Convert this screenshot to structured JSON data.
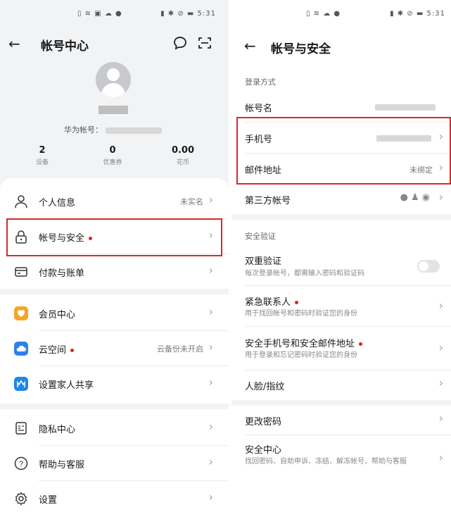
{
  "left": {
    "status_right": "5:31",
    "header": {
      "title": "帐号中心"
    },
    "account_label": "华为帐号：",
    "stats": [
      {
        "value": "2",
        "label": "设备"
      },
      {
        "value": "0",
        "label": "优惠券"
      },
      {
        "value": "0.00",
        "label": "花币"
      }
    ],
    "menu": [
      {
        "label": "个人信息",
        "value": "未实名"
      },
      {
        "label": "帐号与安全",
        "value": ""
      },
      {
        "label": "付款与账单",
        "value": ""
      },
      {
        "label": "会员中心",
        "value": ""
      },
      {
        "label": "云空间",
        "value": "云备份未开启"
      },
      {
        "label": "设置家人共享",
        "value": ""
      },
      {
        "label": "隐私中心",
        "value": ""
      },
      {
        "label": "帮助与客服",
        "value": ""
      },
      {
        "label": "设置",
        "value": ""
      }
    ]
  },
  "right": {
    "status_right": "5:31",
    "header": {
      "title": "帐号与安全"
    },
    "section_login": "登录方式",
    "login_rows": [
      {
        "label": "帐号名"
      },
      {
        "label": "手机号"
      },
      {
        "label": "邮件地址",
        "value": "未绑定"
      },
      {
        "label": "第三方帐号"
      }
    ],
    "section_verify": "安全验证",
    "verify_rows": [
      {
        "label": "双重验证",
        "sub": "每次登录帐号，都需输入密码和验证码"
      },
      {
        "label": "紧急联系人",
        "sub": "用于找回帐号和密码时验证您的身份"
      },
      {
        "label": "安全手机号和安全邮件地址",
        "sub": "用于登录和忘记密码时验证您的身份"
      },
      {
        "label": "人脸/指纹"
      }
    ],
    "other_rows": [
      {
        "label": "更改密码"
      },
      {
        "label": "安全中心",
        "sub": "找回密码、自助申诉、冻结、解冻帐号、帮助与客服"
      }
    ]
  },
  "colors": {
    "highlight": "#d9282b",
    "badge": "#e02020",
    "member": "#f5a623",
    "cloud": "#2f80ed",
    "family": "#1e88e5"
  }
}
